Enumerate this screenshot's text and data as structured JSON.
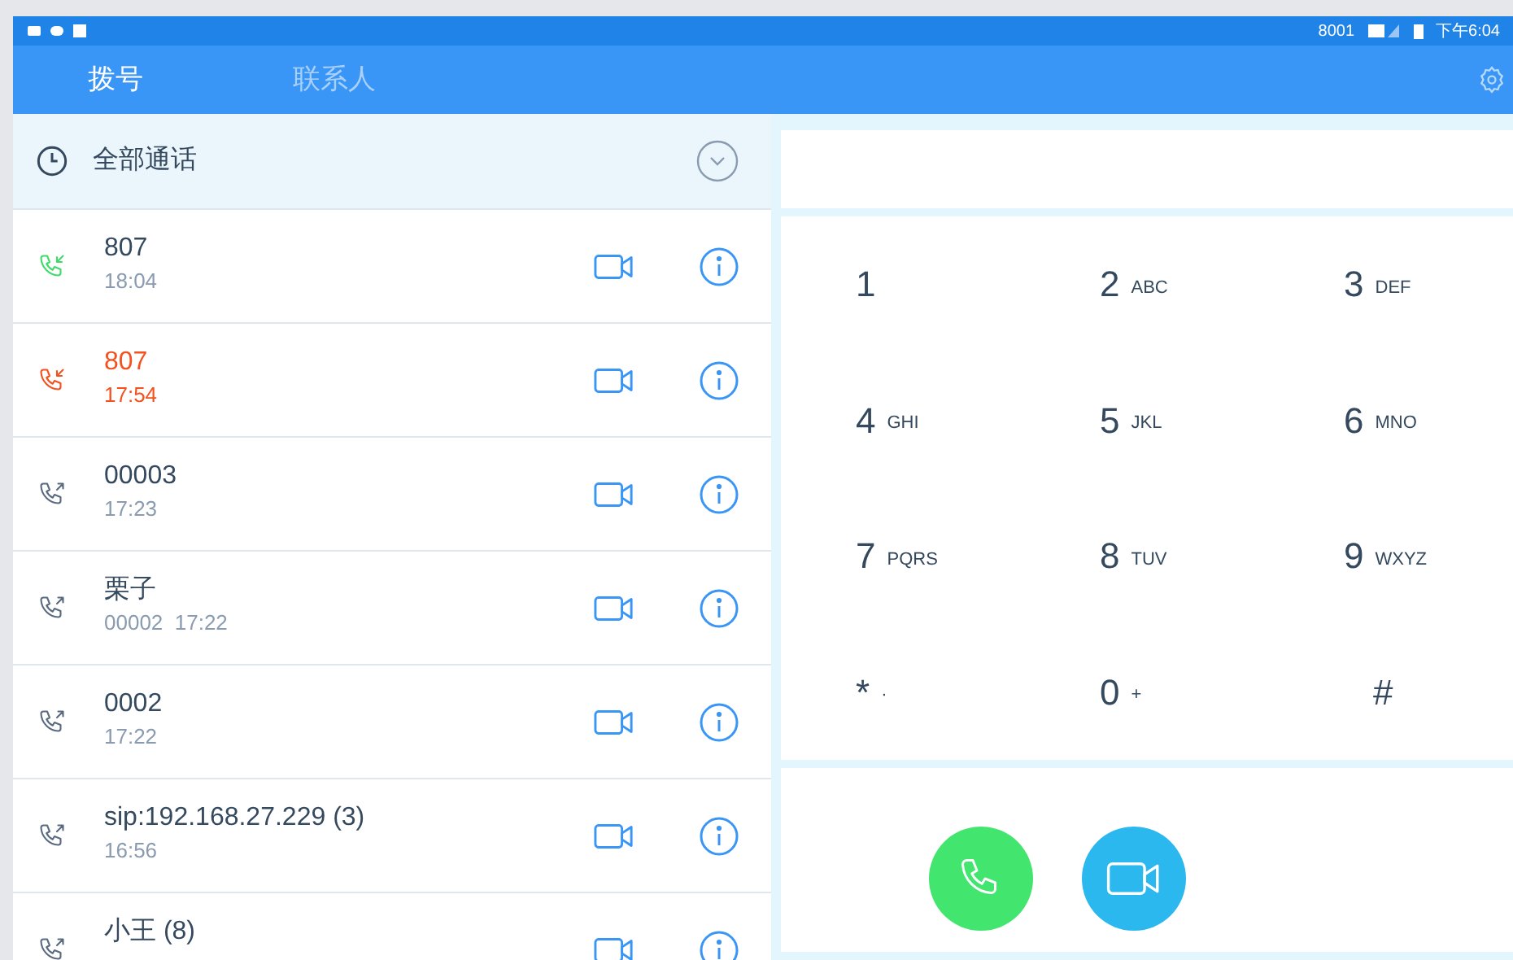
{
  "status_bar": {
    "account": "8001",
    "time": "下午6:04"
  },
  "tabs": [
    {
      "label": "拨号",
      "selected": true
    },
    {
      "label": "联系人",
      "selected": false
    }
  ],
  "filter": {
    "label": "全部通话"
  },
  "calls": [
    {
      "kind": "incoming",
      "title": "807",
      "subtitle": "18:04"
    },
    {
      "kind": "missed",
      "title": "807",
      "subtitle": "17:54"
    },
    {
      "kind": "outgoing",
      "title": "00003",
      "subtitle": "17:23"
    },
    {
      "kind": "outgoing",
      "title": "栗子",
      "subtitle": "00002  17:22"
    },
    {
      "kind": "outgoing",
      "title": "0002",
      "subtitle": "17:22"
    },
    {
      "kind": "outgoing",
      "title": "sip:192.168.27.229 (3)",
      "subtitle": "16:56"
    },
    {
      "kind": "outgoing",
      "title": "小王 (8)"
    }
  ],
  "keypad": [
    {
      "digit": "1"
    },
    {
      "digit": "2",
      "letters": "ABC"
    },
    {
      "digit": "3",
      "letters": "DEF"
    },
    {
      "digit": "4",
      "letters": "GHI"
    },
    {
      "digit": "5",
      "letters": "JKL"
    },
    {
      "digit": "6",
      "letters": "MNO"
    },
    {
      "digit": "7",
      "letters": "PQRS"
    },
    {
      "digit": "8",
      "letters": "TUV"
    },
    {
      "digit": "9",
      "letters": "WXYZ"
    },
    {
      "digit": "*",
      "letters": "·"
    },
    {
      "digit": "0",
      "letters": "+"
    },
    {
      "digit": "#"
    }
  ]
}
